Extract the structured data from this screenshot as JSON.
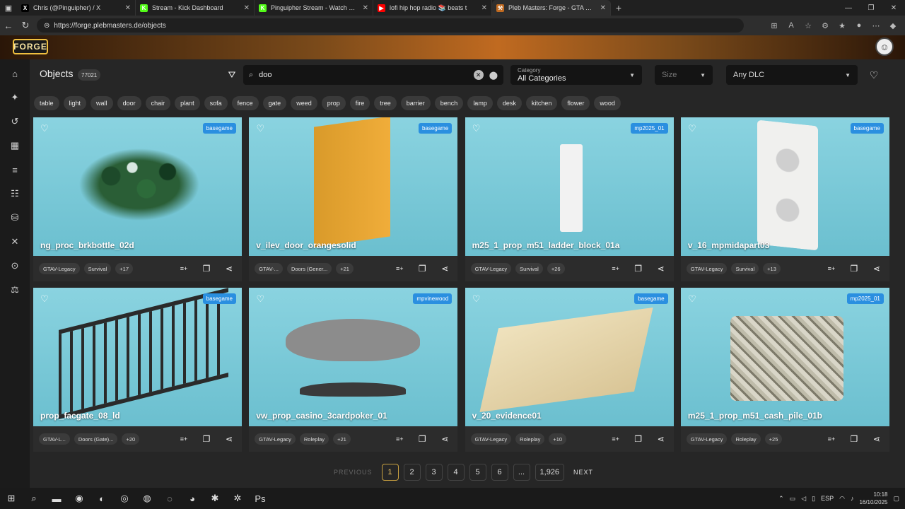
{
  "browser": {
    "tabs": [
      {
        "title": "Chris (@Pinguipher) / X",
        "favicon": "X",
        "color": "#000000"
      },
      {
        "title": "Stream - Kick Dashboard",
        "favicon": "K",
        "color": "#53fc18"
      },
      {
        "title": "Pinguipher Stream - Watch Live o",
        "favicon": "K",
        "color": "#53fc18"
      },
      {
        "title": "lofi hip hop radio 📚 beats t",
        "favicon": "▶",
        "color": "#ff0000"
      },
      {
        "title": "Pleb Masters: Forge - GTA V Obje",
        "favicon": "⚒",
        "color": "#c06a20"
      }
    ],
    "url": "https://forge.plebmasters.de/objects"
  },
  "site": {
    "logo": "FORGE"
  },
  "toolbar": {
    "title": "Objects",
    "count": "77021",
    "search_value": "doo",
    "category_label": "Category",
    "category_value": "All Categories",
    "size_value": "Size",
    "dlc_value": "Any DLC"
  },
  "tags": [
    "table",
    "light",
    "wall",
    "door",
    "chair",
    "plant",
    "sofa",
    "fence",
    "gate",
    "weed",
    "prop",
    "fire",
    "tree",
    "barrier",
    "bench",
    "lamp",
    "desk",
    "kitchen",
    "flower",
    "wood"
  ],
  "objects": [
    {
      "name": "ng_proc_brkbottle_02d",
      "dlc": "basegame",
      "chip1": "GTAV-Legacy",
      "chip2": "Survival",
      "more": "+17",
      "art": "glass"
    },
    {
      "name": "v_ilev_door_orangesolid",
      "dlc": "basegame",
      "chip1": "GTAV-...",
      "chip2": "Doors (Gener...",
      "more": "+21",
      "art": "door"
    },
    {
      "name": "m25_1_prop_m51_ladder_block_01a",
      "dlc": "mp2025_01",
      "chip1": "GTAV-Legacy",
      "chip2": "Survival",
      "more": "+26",
      "art": "ladder"
    },
    {
      "name": "v_16_mpmidapart03",
      "dlc": "basegame",
      "chip1": "GTAV-Legacy",
      "chip2": "Survival",
      "more": "+13",
      "art": "outlet"
    },
    {
      "name": "prop_facgate_08_ld",
      "dlc": "basegame",
      "chip1": "GTAV-L...",
      "chip2": "Doors (Gate)...",
      "more": "+20",
      "art": "fence"
    },
    {
      "name": "vw_prop_casino_3cardpoker_01",
      "dlc": "mpvinewood",
      "chip1": "GTAV-Legacy",
      "chip2": "Roleplay",
      "more": "+21",
      "art": "table"
    },
    {
      "name": "v_20_evidence01",
      "dlc": "basegame",
      "chip1": "GTAV-Legacy",
      "chip2": "Roleplay",
      "more": "+10",
      "art": "envelope"
    },
    {
      "name": "m25_1_prop_m51_cash_pile_01b",
      "dlc": "mp2025_01",
      "chip1": "GTAV-Legacy",
      "chip2": "Roleplay",
      "more": "+25",
      "art": "cash"
    }
  ],
  "pagination": {
    "prev": "PREVIOUS",
    "pages": [
      "1",
      "2",
      "3",
      "4",
      "5",
      "6",
      "...",
      "1,926"
    ],
    "current": "1",
    "next": "NEXT"
  },
  "taskbar": {
    "lang": "ESP",
    "time": "10:18",
    "date": "16/10/2025"
  }
}
